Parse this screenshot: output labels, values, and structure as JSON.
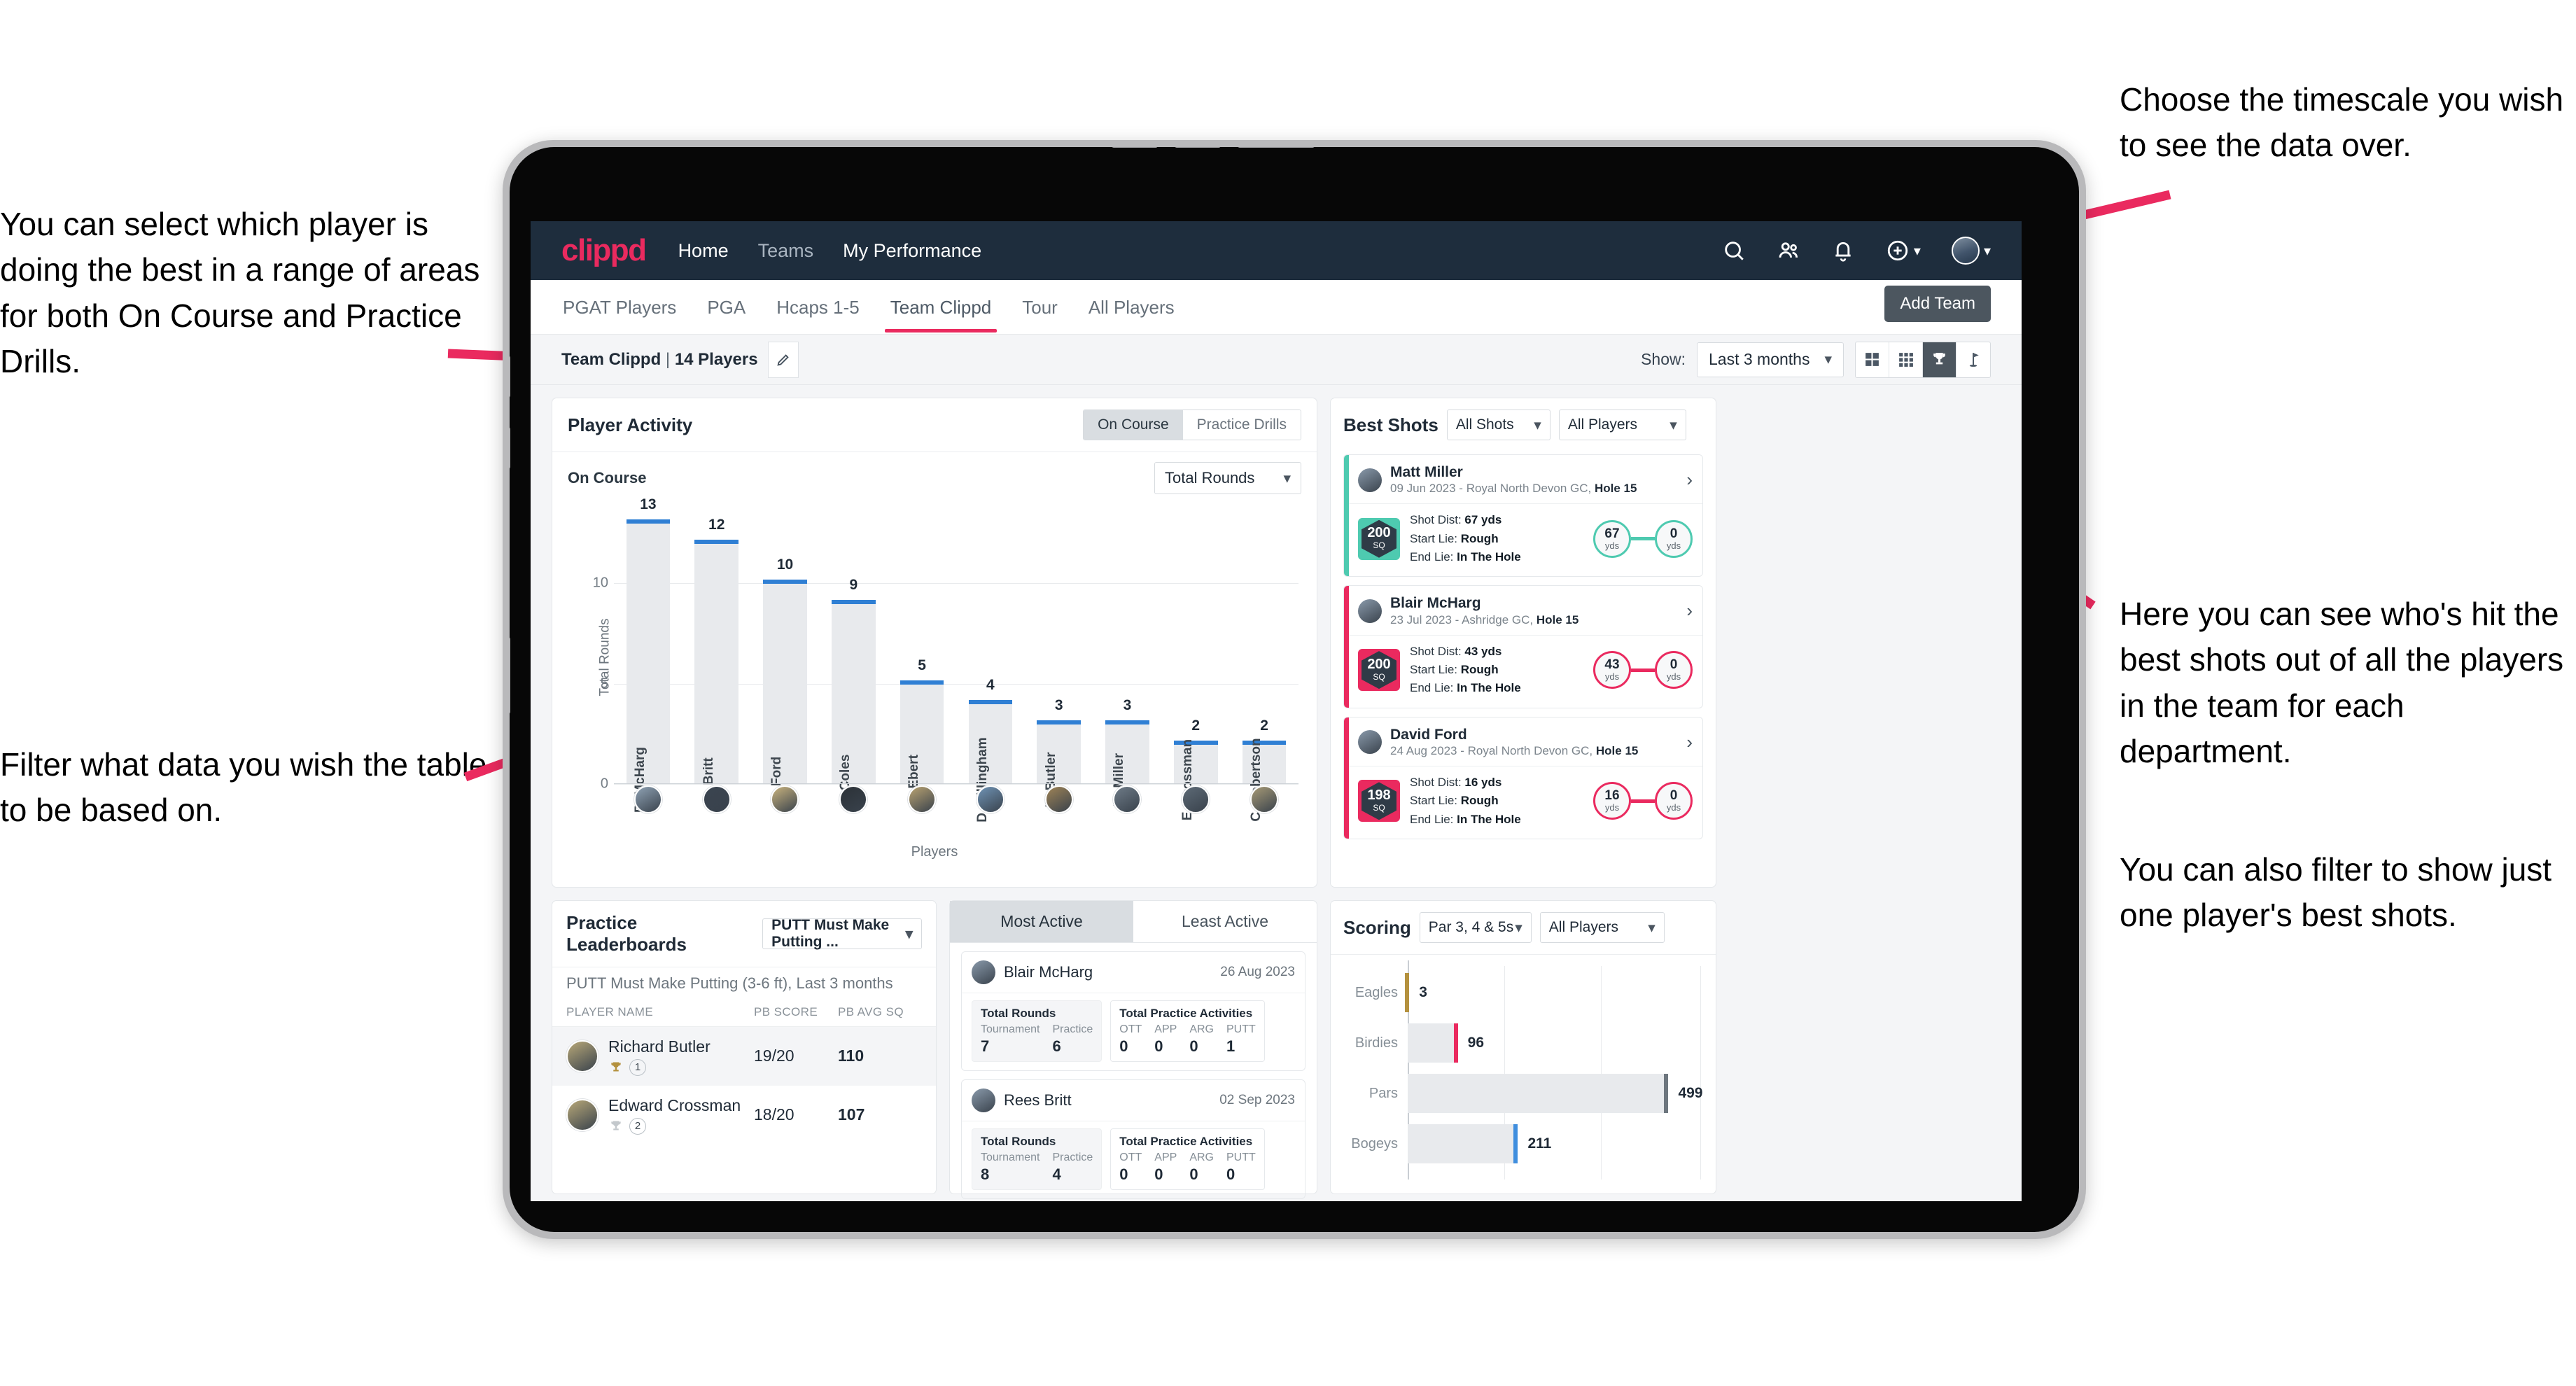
{
  "annotations": {
    "left_top": "You can select which player is doing the best in a range of areas for both On Course and Practice Drills.",
    "left_bottom": "Filter what data you wish the table to be based on.",
    "right_top": "Choose the timescale you wish to see the data over.",
    "right_middle": "Here you can see who's hit the best shots out of all the players in the team for each department.",
    "right_bottom": "You can also filter to show just one player's best shots."
  },
  "colors": {
    "brand_pink": "#ea2a5f",
    "navy": "#1e2d3d",
    "bar_blue": "#2f7fd4",
    "teal": "#4ecab0",
    "gold": "#b4913e",
    "page_bg": "#f4f5f7"
  },
  "navbar": {
    "logo": "clippd",
    "links": [
      {
        "label": "Home",
        "active": true
      },
      {
        "label": "Teams",
        "active": false
      },
      {
        "label": "My Performance",
        "active": true
      }
    ],
    "icons": [
      "search-icon",
      "people-icon",
      "bell-icon",
      "plus-circle-icon",
      "avatar"
    ]
  },
  "subtabs": {
    "items": [
      {
        "label": "PGAT Players",
        "active": false
      },
      {
        "label": "PGA",
        "active": false
      },
      {
        "label": "Hcaps 1-5",
        "active": false
      },
      {
        "label": "Team Clippd",
        "active": true
      },
      {
        "label": "Tour",
        "active": false
      },
      {
        "label": "All Players",
        "active": false
      }
    ],
    "tooltip": "Add Team"
  },
  "toolbar": {
    "team_name": "Team Clippd",
    "team_separator": " | ",
    "team_count": "14 Players",
    "show_label": "Show:",
    "timescale_value": "Last 3 months",
    "view_toggles": [
      {
        "icon": "grid-2x2-icon",
        "active": false
      },
      {
        "icon": "grid-3x3-icon",
        "active": false
      },
      {
        "icon": "trophy-icon",
        "active": true
      },
      {
        "icon": "golf-flag-icon",
        "active": false
      }
    ]
  },
  "player_activity": {
    "title": "Player Activity",
    "segments": [
      {
        "label": "On Course",
        "active": true
      },
      {
        "label": "Practice Drills",
        "active": false
      }
    ],
    "subtitle": "On Course",
    "metric_select": "Total Rounds"
  },
  "chart_data": [
    {
      "type": "bar",
      "title": "Player Activity - On Course",
      "xlabel": "Players",
      "ylabel": "Total Rounds",
      "ylim": [
        0,
        13.8
      ],
      "yticks": [
        0,
        5,
        10
      ],
      "grid": true,
      "categories": [
        "B. McHarg",
        "R. Britt",
        "D. Ford",
        "J. Coles",
        "E. Ebert",
        "D. Billingham",
        "R. Butler",
        "M. Miller",
        "E. Crossman",
        "C. Robertson"
      ],
      "values": [
        13,
        12,
        10,
        9,
        5,
        4,
        3,
        3,
        2,
        2
      ]
    },
    {
      "type": "bar",
      "orientation": "horizontal",
      "title": "Scoring",
      "categories": [
        "Eagles",
        "Birdies",
        "Pars",
        "Bogeys"
      ],
      "values": [
        3,
        96,
        499,
        211
      ],
      "cap_colors": [
        "#b4913e",
        "#ea2a5f",
        "#6d767e",
        "#3f8ede"
      ],
      "xlim": [
        0,
        560
      ],
      "grid": true
    }
  ],
  "best_shots": {
    "title": "Best Shots",
    "shot_filter": "All Shots",
    "player_filter": "All Players",
    "cards": [
      {
        "player": "Matt Miller",
        "meta_date": "09 Jun 2023",
        "meta_course": " - Royal North Devon GC, ",
        "meta_hole": "Hole 15",
        "sq": "200",
        "sq_unit": "SQ",
        "badge_color": "#4ecab0",
        "shot_dist_label": "Shot Dist: ",
        "shot_dist": "67 yds",
        "start_lie_label": "Start Lie: ",
        "start_lie": "Rough",
        "end_lie_label": "End Lie: ",
        "end_lie": "In The Hole",
        "from_value": "67",
        "from_unit": "yds",
        "to_value": "0",
        "to_unit": "yds"
      },
      {
        "player": "Blair McHarg",
        "meta_date": "23 Jul 2023",
        "meta_course": " - Ashridge GC, ",
        "meta_hole": "Hole 15",
        "sq": "200",
        "sq_unit": "SQ",
        "badge_color": "#ea2a5f",
        "shot_dist_label": "Shot Dist: ",
        "shot_dist": "43 yds",
        "start_lie_label": "Start Lie: ",
        "start_lie": "Rough",
        "end_lie_label": "End Lie: ",
        "end_lie": "In The Hole",
        "from_value": "43",
        "from_unit": "yds",
        "to_value": "0",
        "to_unit": "yds"
      },
      {
        "player": "David Ford",
        "meta_date": "24 Aug 2023",
        "meta_course": " - Royal North Devon GC, ",
        "meta_hole": "Hole 15",
        "sq": "198",
        "sq_unit": "SQ",
        "badge_color": "#ea2a5f",
        "shot_dist_label": "Shot Dist: ",
        "shot_dist": "16 yds",
        "start_lie_label": "Start Lie: ",
        "start_lie": "Rough",
        "end_lie_label": "End Lie: ",
        "end_lie": "In The Hole",
        "from_value": "16",
        "from_unit": "yds",
        "to_value": "0",
        "to_unit": "yds"
      }
    ]
  },
  "practice_leaderboards": {
    "title": "Practice Leaderboards",
    "drill_select": "PUTT Must Make Putting ...",
    "subtitle_bold": "PUTT Must Make Putting (3-6 ft),",
    "subtitle_light": " Last 3 months",
    "columns": [
      "PLAYER NAME",
      "PB SCORE",
      "PB AVG SQ"
    ],
    "rows": [
      {
        "name": "Richard Butler",
        "rank": "1",
        "trophy": "gold",
        "pb_score": "19/20",
        "pb_avg_sq": "110"
      },
      {
        "name": "Edward Crossman",
        "rank": "2",
        "trophy": "silver",
        "pb_score": "18/20",
        "pb_avg_sq": "107"
      }
    ]
  },
  "activity": {
    "tabs": [
      {
        "label": "Most Active",
        "active": true
      },
      {
        "label": "Least Active",
        "active": false
      }
    ],
    "cards": [
      {
        "player": "Blair McHarg",
        "date": "26 Aug 2023",
        "rounds_title": "Total Rounds",
        "rounds": [
          {
            "key": "Tournament",
            "value": "7"
          },
          {
            "key": "Practice",
            "value": "6"
          }
        ],
        "practice_title": "Total Practice Activities",
        "practice": [
          {
            "key": "OTT",
            "value": "0"
          },
          {
            "key": "APP",
            "value": "0"
          },
          {
            "key": "ARG",
            "value": "0"
          },
          {
            "key": "PUTT",
            "value": "1"
          }
        ]
      },
      {
        "player": "Rees Britt",
        "date": "02 Sep 2023",
        "rounds_title": "Total Rounds",
        "rounds": [
          {
            "key": "Tournament",
            "value": "8"
          },
          {
            "key": "Practice",
            "value": "4"
          }
        ],
        "practice_title": "Total Practice Activities",
        "practice": [
          {
            "key": "OTT",
            "value": "0"
          },
          {
            "key": "APP",
            "value": "0"
          },
          {
            "key": "ARG",
            "value": "0"
          },
          {
            "key": "PUTT",
            "value": "0"
          }
        ]
      }
    ]
  },
  "scoring": {
    "title": "Scoring",
    "par_filter": "Par 3, 4 & 5s",
    "player_filter": "All Players"
  }
}
